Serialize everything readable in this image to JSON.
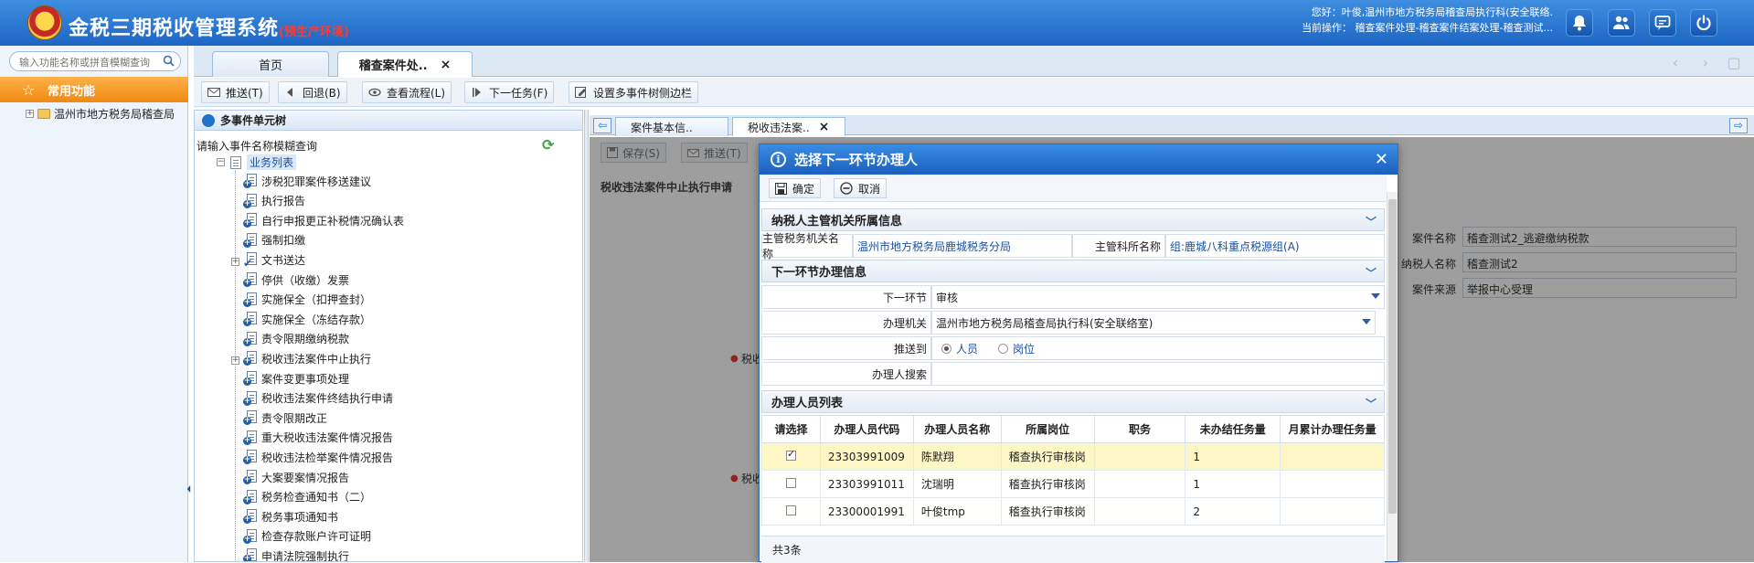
{
  "header": {
    "title": "金税三期税收管理系统",
    "env": "(预生产环境)",
    "user_line": "您好：叶俊,温州市地方税务局稽查局执行科(安全联络.",
    "op_line": "当前操作： 稽查案件处理-稽查案件结案处理-稽查测试..."
  },
  "leftnav": {
    "search_placeholder": "输入功能名称或拼音模糊查询",
    "common_label": "常用功能",
    "tree_root": "温州市地方税务局稽查局"
  },
  "tabs": [
    {
      "label": "首页"
    },
    {
      "label": "稽查案件处.."
    }
  ],
  "toolbar": {
    "push": "推送(T)",
    "back": "回退(B)",
    "view_flow": "查看流程(L)",
    "next_task": "下一任务(F)",
    "set_sidebar": "设置多事件树侧边栏"
  },
  "tree": {
    "title": "多事件单元树",
    "search_label": "请输入事件名称模糊查询",
    "root": "业务列表",
    "items": [
      {
        "label": "涉税犯罪案件移送建议",
        "expandable": false,
        "checked": false
      },
      {
        "label": "执行报告",
        "expandable": false,
        "checked": false
      },
      {
        "label": "自行申报更正补税情况确认表",
        "expandable": false,
        "checked": false
      },
      {
        "label": "强制扣缴",
        "expandable": false,
        "checked": false
      },
      {
        "label": "文书送达",
        "expandable": true,
        "checked": true
      },
      {
        "label": "停供（收缴）发票",
        "expandable": false,
        "checked": false
      },
      {
        "label": "实施保全（扣押查封）",
        "expandable": false,
        "checked": false
      },
      {
        "label": "实施保全（冻结存款）",
        "expandable": false,
        "checked": false
      },
      {
        "label": "责令限期缴纳税款",
        "expandable": false,
        "checked": false
      },
      {
        "label": "税收违法案件中止执行",
        "expandable": true,
        "checked": false
      },
      {
        "label": "案件变更事项处理",
        "expandable": false,
        "checked": false
      },
      {
        "label": "税收违法案件终结执行申请",
        "expandable": false,
        "checked": false
      },
      {
        "label": "责令限期改正",
        "expandable": false,
        "checked": false
      },
      {
        "label": "重大税收违法案件情况报告",
        "expandable": false,
        "checked": false
      },
      {
        "label": "税收违法检举案件情况报告",
        "expandable": false,
        "checked": false
      },
      {
        "label": "大案要案情况报告",
        "expandable": false,
        "checked": false
      },
      {
        "label": "税务检查通知书（二）",
        "expandable": false,
        "checked": false
      },
      {
        "label": "税务事项通知书",
        "expandable": false,
        "checked": false
      },
      {
        "label": "检查存款账户许可证明",
        "expandable": false,
        "checked": false
      },
      {
        "label": "申请法院强制执行",
        "expandable": false,
        "checked": false
      }
    ]
  },
  "workspace": {
    "tabs": [
      {
        "label": "案件基本信.."
      },
      {
        "label": "税收违法案.."
      }
    ],
    "save": "保存(S)",
    "push": "推送(T)",
    "section_title": "税收违法案件中止执行申请",
    "fields": [
      {
        "label": "案件名称",
        "value": "稽查测试2_逃避缴纳税款"
      },
      {
        "label": "纳税人名称",
        "value": "稽查测试2"
      },
      {
        "label": "案件来源",
        "value": "举报中心受理"
      }
    ],
    "partial_label": "税收"
  },
  "dialog": {
    "title": "选择下一环节办理人",
    "confirm": "确定",
    "cancel": "取消",
    "sec1": "纳税人主管机关所属信息",
    "tax_org_label": "主管税务机关名称",
    "tax_org_value": "温州市地方税务局鹿城税务分局",
    "dept_label": "主管科所名称",
    "dept_value": "组:鹿城八科重点税源组(A)",
    "sec2": "下一环节办理信息",
    "next_step_label": "下一环节",
    "next_step_value": "审核",
    "org_label": "办理机关",
    "org_value": "温州市地方税务局稽查局执行科(安全联络室)",
    "push_to_label": "推送到",
    "push_to_options": [
      "人员",
      "岗位"
    ],
    "search_label": "办理人搜索",
    "sec3": "办理人员列表",
    "columns": [
      "请选择",
      "办理人员代码",
      "办理人员名称",
      "所属岗位",
      "职务",
      "未办结任务量",
      "月累计办理任务量"
    ],
    "rows": [
      {
        "selected": true,
        "code": "23303991009",
        "name": "陈默翔",
        "post": "稽查执行审核岗",
        "duty": "",
        "pending": "1",
        "monthly": ""
      },
      {
        "selected": false,
        "code": "23303991011",
        "name": "沈瑞明",
        "post": "稽查执行审核岗",
        "duty": "",
        "pending": "1",
        "monthly": ""
      },
      {
        "selected": false,
        "code": "23300001991",
        "name": "叶俊tmp",
        "post": "稽查执行审核岗",
        "duty": "",
        "pending": "2",
        "monthly": ""
      }
    ],
    "footer": "共3条"
  }
}
